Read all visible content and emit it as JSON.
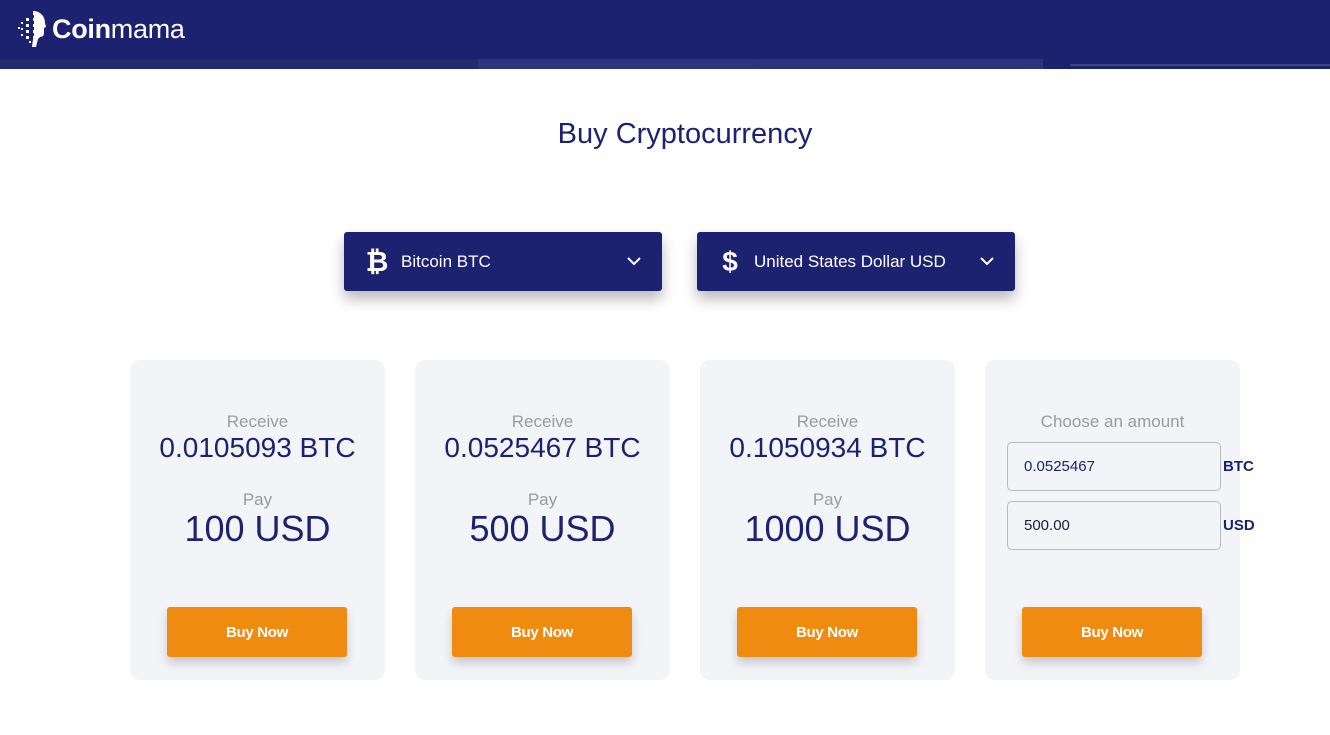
{
  "header": {
    "brand_bold": "Coin",
    "brand_light": "mama"
  },
  "page": {
    "title": "Buy Cryptocurrency"
  },
  "selectors": {
    "crypto": {
      "icon": "bitcoin-icon",
      "glyph": "₿",
      "label": "Bitcoin BTC"
    },
    "fiat": {
      "icon": "dollar-icon",
      "glyph": "$",
      "label": "United States Dollar USD"
    }
  },
  "cards": [
    {
      "receive_label": "Receive",
      "receive_value": "0.0105093 BTC",
      "pay_label": "Pay",
      "pay_value": "100 USD",
      "button": "Buy Now"
    },
    {
      "receive_label": "Receive",
      "receive_value": "0.0525467 BTC",
      "pay_label": "Pay",
      "pay_value": "500 USD",
      "button": "Buy Now"
    },
    {
      "receive_label": "Receive",
      "receive_value": "0.1050934 BTC",
      "pay_label": "Pay",
      "pay_value": "1000 USD",
      "button": "Buy Now"
    }
  ],
  "custom": {
    "label": "Choose an amount",
    "crypto_value": "0.0525467",
    "crypto_unit": "BTC",
    "fiat_value": "500.00",
    "fiat_unit": "USD",
    "button": "Buy Now"
  },
  "colors": {
    "brand_navy": "#1d2270",
    "accent_orange": "#ee8b10",
    "card_bg": "#f3f4f8",
    "muted_text": "#9a9a9f"
  }
}
